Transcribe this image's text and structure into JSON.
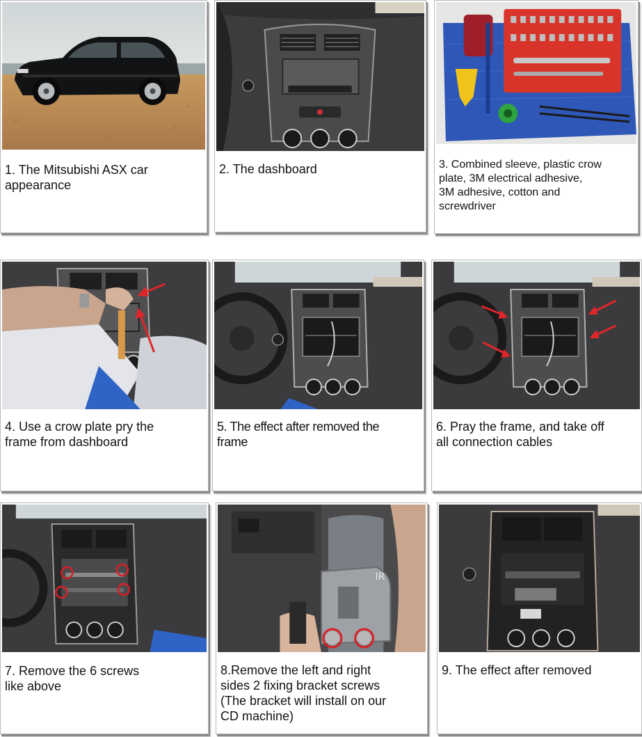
{
  "steps": [
    {
      "caption": "1. The Mitsubishi ASX car\n appearance"
    },
    {
      "caption": "2. The dashboard"
    },
    {
      "caption": "3. Combined sleeve, plastic crow\n plate, 3M electrical adhesive,\n3M adhesive, cotton and\nscrewdriver"
    },
    {
      "caption": "4.  Use a crow plate pry the\nframe from dashboard"
    },
    {
      "caption": "5. The effect after removed the\n frame"
    },
    {
      "caption": "6. Pray the frame, and take off\nall connection cables"
    },
    {
      "caption": "7. Remove the 6 screws\n like above"
    },
    {
      "caption": "8.Remove the left and right\nsides 2 fixing bracket screws\n(The bracket will install on our\nCD machine)"
    },
    {
      "caption": "9. The effect after removed"
    }
  ],
  "photo_labels": {
    "bracket_marking": "IR"
  },
  "colors": {
    "arrow_red": "#e0262a",
    "screw_circle": "#d81f26",
    "dash_gray": "#3a3a3c",
    "card_border": "#b9b9b9"
  }
}
